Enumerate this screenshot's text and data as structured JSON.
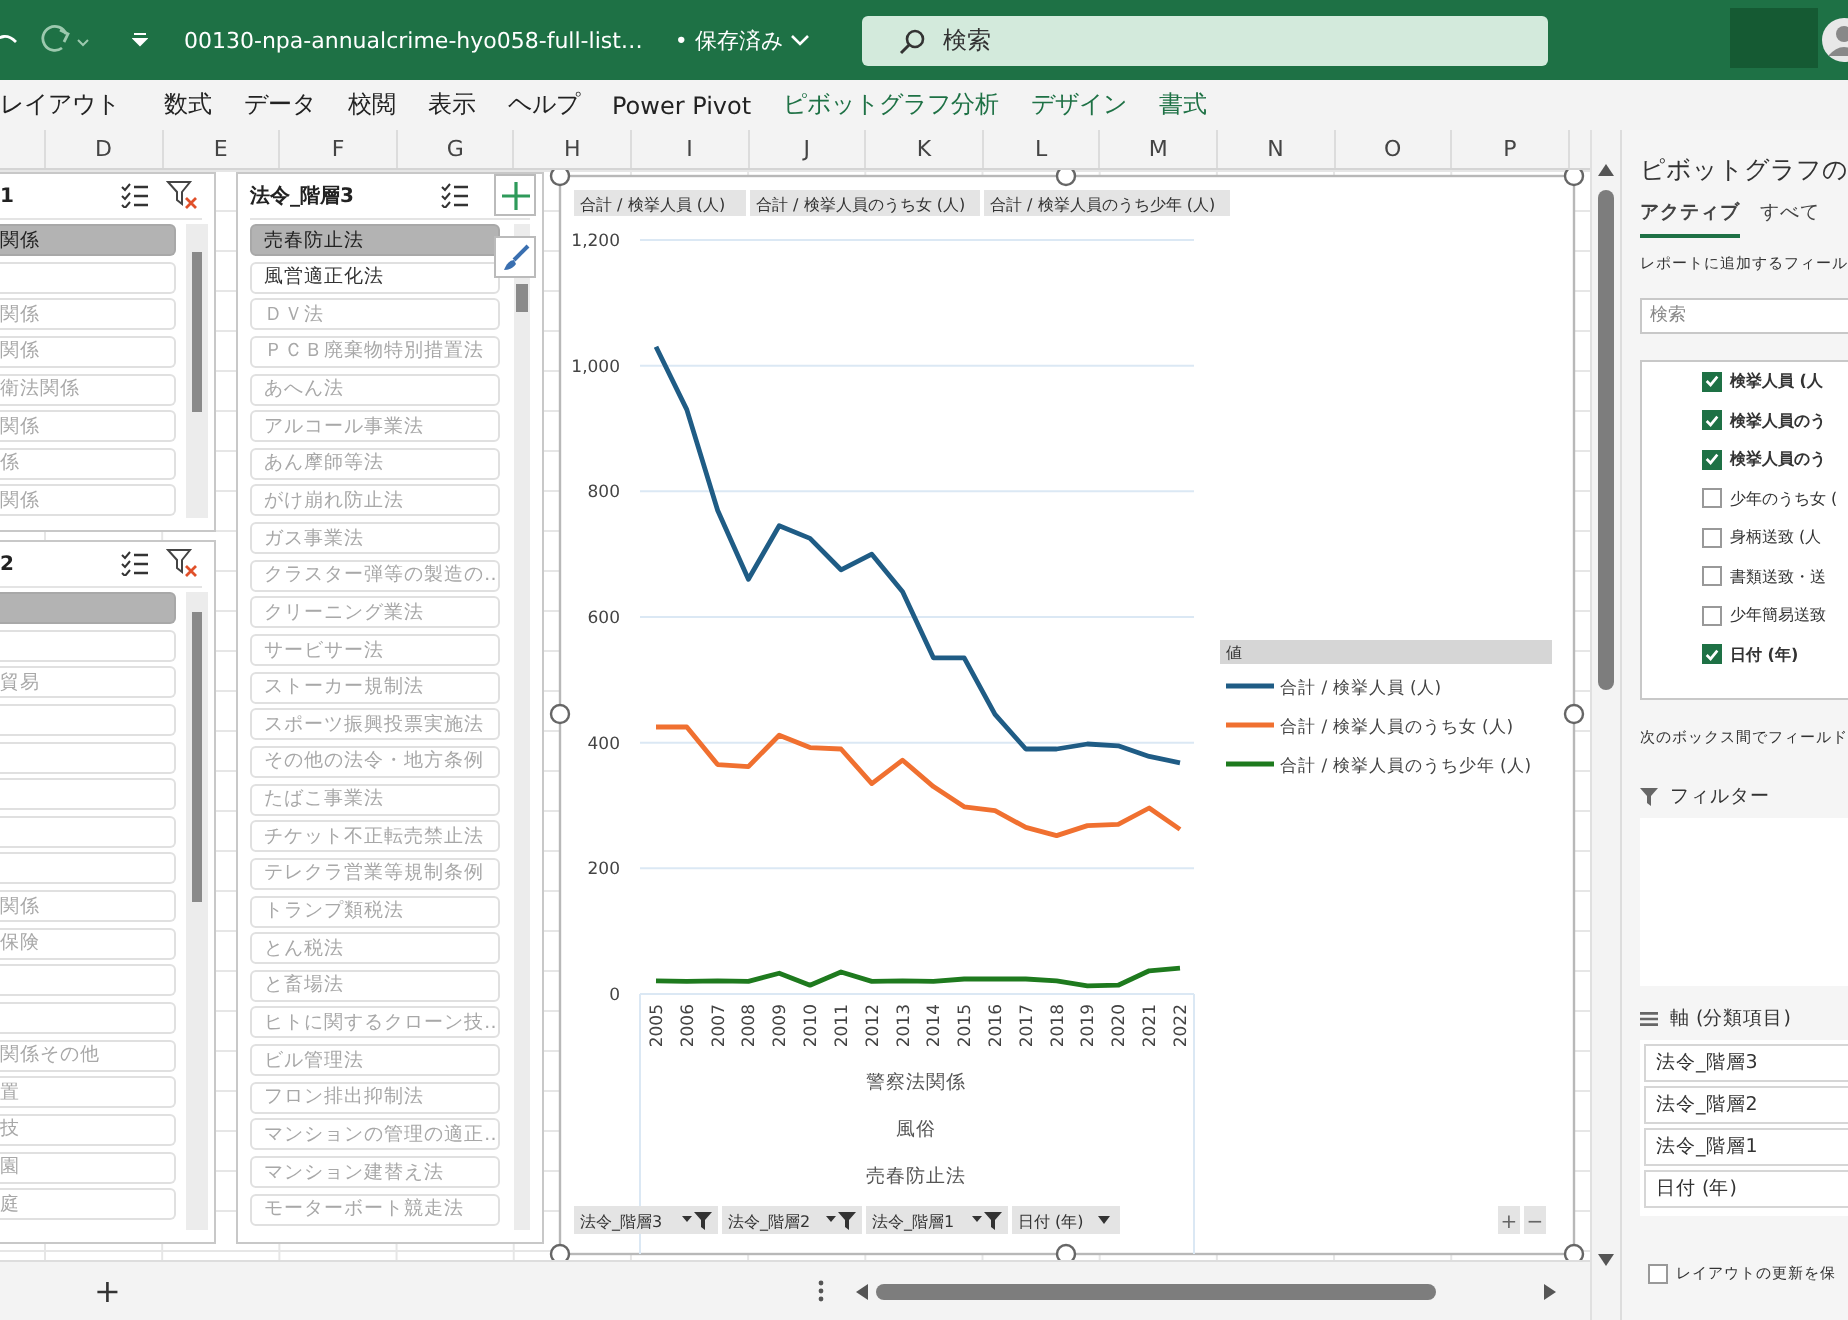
{
  "title_bar": {
    "file_name": "00130-npa-annualcrime-hyo058-full-list…",
    "save_status": "• 保存済み",
    "search": {
      "placeholder": "検索"
    }
  },
  "ribbon_tabs": [
    {
      "label": "レイアウト",
      "kind": "standard"
    },
    {
      "label": "数式",
      "kind": "standard"
    },
    {
      "label": "データ",
      "kind": "standard"
    },
    {
      "label": "校閲",
      "kind": "standard"
    },
    {
      "label": "表示",
      "kind": "standard"
    },
    {
      "label": "ヘルプ",
      "kind": "standard"
    },
    {
      "label": "Power Pivot",
      "kind": "standard"
    },
    {
      "label": "ピボットグラフ分析",
      "kind": "contextual"
    },
    {
      "label": "デザイン",
      "kind": "contextual"
    },
    {
      "label": "書式",
      "kind": "contextual"
    }
  ],
  "column_headers": [
    "D",
    "E",
    "F",
    "G",
    "H",
    "I",
    "J",
    "K",
    "L",
    "M",
    "N",
    "O",
    "P"
  ],
  "slicers": [
    {
      "title": "1",
      "items": [
        {
          "label": "関係",
          "selected": true,
          "disabled": false
        },
        {
          "selected": false
        },
        {
          "label": "関係",
          "selected": false,
          "disabled": true
        },
        {
          "label": "関係",
          "selected": false,
          "disabled": true
        },
        {
          "label": "衛法関係",
          "selected": false,
          "disabled": true
        },
        {
          "label": "関係",
          "selected": false,
          "disabled": true
        },
        {
          "label": "係",
          "selected": false,
          "disabled": true
        },
        {
          "label": "関係",
          "selected": false,
          "disabled": true
        }
      ]
    },
    {
      "title": "2",
      "items": [
        {
          "selected": true
        },
        {
          "selected": false
        },
        {
          "label": "貿易",
          "selected": false,
          "disabled": true
        },
        {
          "selected": false
        },
        {
          "selected": false
        },
        {
          "selected": false
        },
        {
          "selected": false
        },
        {
          "selected": false
        },
        {
          "label": "関係",
          "selected": false,
          "disabled": true
        },
        {
          "label": "保険",
          "selected": false,
          "disabled": true
        },
        {
          "selected": false
        },
        {
          "selected": false
        },
        {
          "label": "関係その他",
          "selected": false,
          "disabled": true
        },
        {
          "label": "置",
          "selected": false,
          "disabled": true
        },
        {
          "label": "技",
          "selected": false,
          "disabled": true
        },
        {
          "label": "園",
          "selected": false,
          "disabled": true
        },
        {
          "label": "庭",
          "selected": false,
          "disabled": true
        }
      ]
    },
    {
      "title": "法令_階層3",
      "items": [
        {
          "label": "売春防止法",
          "selected": true,
          "disabled": false
        },
        {
          "label": "風営適正化法",
          "selected": false,
          "disabled": false
        },
        {
          "label": "ＤＶ法",
          "selected": false,
          "disabled": true
        },
        {
          "label": "ＰＣＢ廃棄物特別措置法",
          "selected": false,
          "disabled": true
        },
        {
          "label": "あへん法",
          "selected": false,
          "disabled": true
        },
        {
          "label": "アルコール事業法",
          "selected": false,
          "disabled": true
        },
        {
          "label": "あん摩師等法",
          "selected": false,
          "disabled": true
        },
        {
          "label": "がけ崩れ防止法",
          "selected": false,
          "disabled": true
        },
        {
          "label": "ガス事業法",
          "selected": false,
          "disabled": true
        },
        {
          "label": "クラスター弾等の製造の…",
          "selected": false,
          "disabled": true
        },
        {
          "label": "クリーニング業法",
          "selected": false,
          "disabled": true
        },
        {
          "label": "サービサー法",
          "selected": false,
          "disabled": true
        },
        {
          "label": "ストーカー規制法",
          "selected": false,
          "disabled": true
        },
        {
          "label": "スポーツ振興投票実施法",
          "selected": false,
          "disabled": true
        },
        {
          "label": "その他の法令・地方条例",
          "selected": false,
          "disabled": true
        },
        {
          "label": "たばこ事業法",
          "selected": false,
          "disabled": true
        },
        {
          "label": "チケット不正転売禁止法",
          "selected": false,
          "disabled": true
        },
        {
          "label": "テレクラ営業等規制条例",
          "selected": false,
          "disabled": true
        },
        {
          "label": "トランプ類税法",
          "selected": false,
          "disabled": true
        },
        {
          "label": "とん税法",
          "selected": false,
          "disabled": true
        },
        {
          "label": "と畜場法",
          "selected": false,
          "disabled": true
        },
        {
          "label": "ヒトに関するクローン技…",
          "selected": false,
          "disabled": true
        },
        {
          "label": "ビル管理法",
          "selected": false,
          "disabled": true
        },
        {
          "label": "フロン排出抑制法",
          "selected": false,
          "disabled": true
        },
        {
          "label": "マンションの管理の適正…",
          "selected": false,
          "disabled": true
        },
        {
          "label": "マンション建替え法",
          "selected": false,
          "disabled": true
        },
        {
          "label": "モーターボート競走法",
          "selected": false,
          "disabled": true
        }
      ]
    }
  ],
  "chart": {
    "value_buttons": [
      "合計 / 検挙人員 (人)",
      "合計 / 検挙人員のうち女 (人)",
      "合計 / 検挙人員のうち少年 (人)"
    ],
    "legend_title": "値",
    "category_levels": [
      "警察法関係",
      "風俗",
      "売春防止法"
    ],
    "axis_buttons": [
      {
        "label": "法令_階層3",
        "kind": "filtered"
      },
      {
        "label": "法令_階層2",
        "kind": "filtered"
      },
      {
        "label": "法令_階層1",
        "kind": "filtered"
      },
      {
        "label": "日付 (年)",
        "kind": "plain"
      }
    ],
    "zoom_buttons": [
      "+",
      "−"
    ],
    "chart_data": {
      "type": "line",
      "categories": [
        "2005",
        "2006",
        "2007",
        "2008",
        "2009",
        "2010",
        "2011",
        "2012",
        "2013",
        "2014",
        "2015",
        "2016",
        "2017",
        "2018",
        "2019",
        "2020",
        "2021",
        "2022"
      ],
      "series": [
        {
          "name": "合計 / 検挙人員 (人)",
          "color": "#1f5c85",
          "values": [
            1030,
            930,
            770,
            660,
            745,
            725,
            675,
            700,
            640,
            535,
            535,
            445,
            390,
            390,
            398,
            395,
            378,
            368
          ]
        },
        {
          "name": "合計 / 検挙人員のうち女 (人)",
          "color": "#f07030",
          "values": [
            425,
            425,
            365,
            362,
            412,
            392,
            390,
            335,
            372,
            330,
            298,
            292,
            265,
            252,
            268,
            270,
            296,
            262
          ]
        },
        {
          "name": "合計 / 検挙人員のうち少年 (人)",
          "color": "#1e7a1e",
          "values": [
            21,
            20,
            21,
            20,
            33,
            14,
            35,
            20,
            21,
            20,
            24,
            24,
            24,
            21,
            13,
            14,
            37,
            41
          ]
        }
      ],
      "ylim": [
        0,
        1200
      ],
      "grid": true,
      "legend": "right",
      "yticks": [
        0,
        200,
        400,
        600,
        800,
        {
          "value": 1000,
          "label": "1,000"
        },
        {
          "value": 1200,
          "label": "1,200"
        }
      ]
    }
  },
  "field_pane": {
    "title": "ピボットグラフの",
    "tabs": [
      {
        "label": "アクティブ",
        "selected": true
      },
      {
        "label": "すべて",
        "selected": false
      }
    ],
    "hint": "レポートに追加するフィール",
    "search": {
      "placeholder": "検索"
    },
    "fields": [
      {
        "label": "検挙人員 (人",
        "checked": true
      },
      {
        "label": "検挙人員のう",
        "checked": true
      },
      {
        "label": "検挙人員のう",
        "checked": true
      },
      {
        "label": "少年のうち女 (",
        "checked": false
      },
      {
        "label": "身柄送致 (人",
        "checked": false
      },
      {
        "label": "書類送致・送",
        "checked": false
      },
      {
        "label": "少年簡易送致",
        "checked": false
      },
      {
        "label": "日付 (年)",
        "checked": true
      }
    ],
    "areas_hint": "次のボックス間でフィールド",
    "filter_label": "フィルター",
    "axis_label": "軸 (分類項目)",
    "axis_items": [
      "法令_階層3",
      "法令_階層2",
      "法令_階層1",
      "日付 (年)"
    ],
    "defer_update": {
      "label": "レイアウトの更新を保",
      "checked": false
    }
  },
  "sheet_bar": {
    "add_label": "+"
  }
}
